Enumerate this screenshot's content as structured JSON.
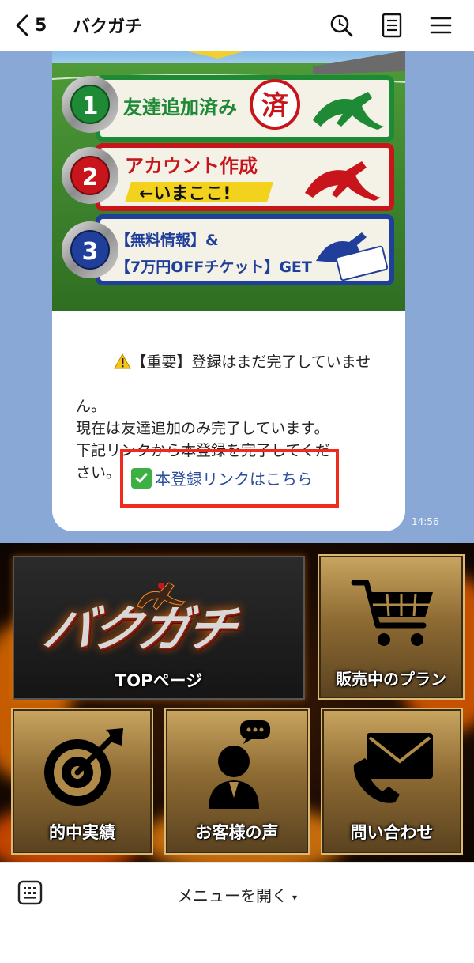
{
  "header": {
    "back_count": "5",
    "title": "バクガチ",
    "icons": [
      "back-chevron-icon",
      "search-icon",
      "notes-icon",
      "menu-icon"
    ]
  },
  "message": {
    "banner": {
      "steps": [
        {
          "number": "1",
          "text": "友達追加済み",
          "stamp": "済"
        },
        {
          "number": "2",
          "text": "アカウント作成",
          "sub": "←いまここ!"
        },
        {
          "number": "3",
          "line1": "【無料情報】&",
          "line2": "【7万円OFFチケット】GET"
        }
      ]
    },
    "warning_icon": "warning-icon",
    "lines": [
      "【重要】登録はまだ完了していませ",
      "ん。",
      "現在は友達追加のみ完了しています。",
      "下記リンクから本登録を完了してくだ",
      "さい。"
    ],
    "link_text": "本登録リンクはこちら",
    "time": "14:56"
  },
  "richmenu": {
    "logo": "バクガチ",
    "tiles": [
      {
        "label": "TOPページ",
        "icon": "logo-horse-icon"
      },
      {
        "label": "販売中のプラン",
        "icon": "cart-icon"
      },
      {
        "label": "的中実績",
        "icon": "target-icon"
      },
      {
        "label": "お客様の声",
        "icon": "person-chat-icon"
      },
      {
        "label": "問い合わせ",
        "icon": "mail-phone-icon"
      }
    ]
  },
  "bottombar": {
    "menu_label": "メニューを開く",
    "caret": "▾"
  },
  "colors": {
    "chat_bg": "#8aa8d6",
    "link": "#2b4f9c",
    "highlight_border": "#ef2b1d",
    "step1": "#1e8a35",
    "step2": "#c8151c",
    "step3": "#1f3f9a"
  }
}
